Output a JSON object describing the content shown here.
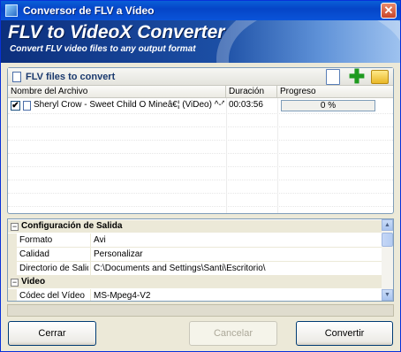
{
  "window": {
    "title": "Conversor de FLV a Vídeo",
    "close_label": "✕"
  },
  "banner": {
    "title": "FLV to VideoX Converter",
    "subtitle": "Convert FLV video files to any output format"
  },
  "file_panel": {
    "title": "FLV files to convert",
    "columns": {
      "name": "Nombre del Archivo",
      "duration": "Duración",
      "progress": "Progreso"
    },
    "rows": [
      {
        "checked": true,
        "check_glyph": "✔",
        "name": "Sheryl Crow - Sweet Child O Mineâ€¦ (ViDeo) ^-^.flv",
        "duration": "00:03:56",
        "progress": "0 %"
      }
    ],
    "toolbar": {
      "add_glyph": "✚"
    }
  },
  "properties": {
    "categories": [
      {
        "label": "Configuración de Salida",
        "expander": "−",
        "rows": [
          {
            "name": "Formato",
            "value": "Avi"
          },
          {
            "name": "Calidad",
            "value": "Personalizar"
          },
          {
            "name": "Directorio de Salida",
            "value": "C:\\Documents and Settings\\Santi\\Escritorio\\"
          }
        ]
      },
      {
        "label": "Video",
        "expander": "−",
        "rows": [
          {
            "name": "Códec del Vídeo",
            "value": "MS-Mpeg4-V2"
          }
        ]
      }
    ],
    "scroll_up": "▲",
    "scroll_down": "▼"
  },
  "buttons": {
    "close": "Cerrar",
    "cancel": "Cancelar",
    "convert": "Convertir"
  }
}
